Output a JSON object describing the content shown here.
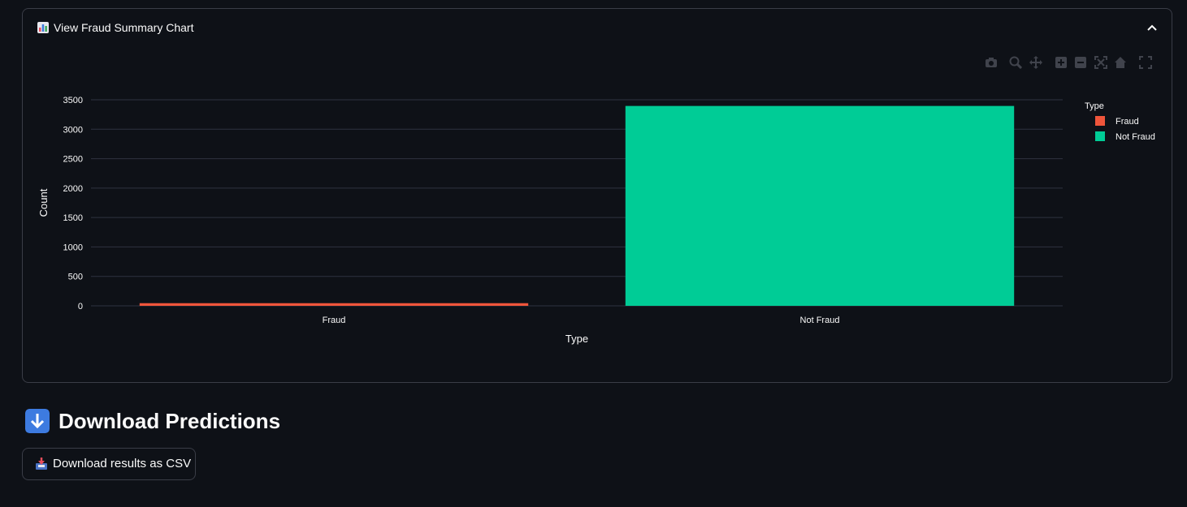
{
  "expander": {
    "title": "View Fraud Summary Chart",
    "icon": "bar-chart-emoji-icon",
    "expanded_icon": "chevron-up-icon"
  },
  "modebar": {
    "buttons": [
      "camera-icon",
      "zoom-icon",
      "pan-icon",
      "zoom-in-icon",
      "zoom-out-icon",
      "autoscale-icon",
      "reset-axes-icon",
      "fullscreen-icon"
    ]
  },
  "chart_data": {
    "type": "bar",
    "categories": [
      "Fraud",
      "Not Fraud"
    ],
    "series": [
      {
        "name": "Fraud",
        "category": "Fraud",
        "value": 45,
        "color": "#ef553b"
      },
      {
        "name": "Not Fraud",
        "category": "Not Fraud",
        "value": 3395,
        "color": "#00cc96"
      }
    ],
    "xlabel": "Type",
    "ylabel": "Count",
    "ylim": [
      0,
      3500
    ],
    "yticks": [
      0,
      500,
      1000,
      1500,
      2000,
      2500,
      3000,
      3500
    ],
    "legend_title": "Type",
    "legend_position": "top-right",
    "grid": true
  },
  "download_section": {
    "heading": "Download Predictions",
    "heading_icon": "down-arrow-emoji-icon",
    "button_label": "Download results as CSV",
    "button_icon": "inbox-tray-icon"
  },
  "colors": {
    "background": "#0e1117",
    "border": "#3a3d47",
    "text": "#fafafa",
    "grid": "#2f3340"
  }
}
